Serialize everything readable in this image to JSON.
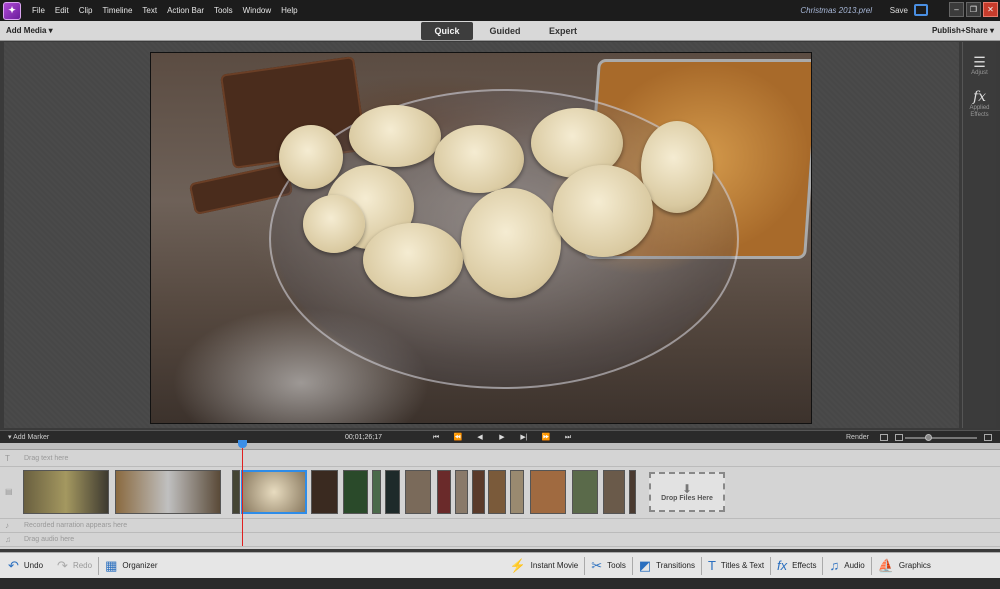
{
  "menu": {
    "items": [
      "File",
      "Edit",
      "Clip",
      "Timeline",
      "Text",
      "Action Bar",
      "Tools",
      "Window",
      "Help"
    ],
    "document_title": "Christmas 2013.prel",
    "save_label": "Save"
  },
  "window_controls": {
    "minimize": "‒",
    "restore": "❐",
    "close": "✕"
  },
  "modebar": {
    "add_media": "Add Media ▾",
    "modes": [
      "Quick",
      "Guided",
      "Expert"
    ],
    "active_mode": "Quick",
    "publish": "Publish+Share ▾"
  },
  "right_panel": {
    "adjust_label": "Adjust",
    "effects_label": "Applied Effects",
    "effects_icon": "fx"
  },
  "timeline": {
    "add_marker": "Add Marker",
    "timecode": "00;01;26;17",
    "render": "Render",
    "tracks": {
      "text": "Drag text here",
      "narration": "Recorded narration appears here",
      "audio": "Drag audio here"
    },
    "drop_files": "Drop Files Here"
  },
  "bottombar": {
    "undo": "Undo",
    "redo": "Redo",
    "organizer": "Organizer",
    "instant_movie": "Instant Movie",
    "tools": "Tools",
    "transitions": "Transitions",
    "titles_text": "Titles & Text",
    "effects": "Effects",
    "audio": "Audio",
    "graphics": "Graphics"
  },
  "colors": {
    "accent": "#2e8ce8",
    "playhead": "#e02020",
    "logo": "#8a2fc0"
  }
}
